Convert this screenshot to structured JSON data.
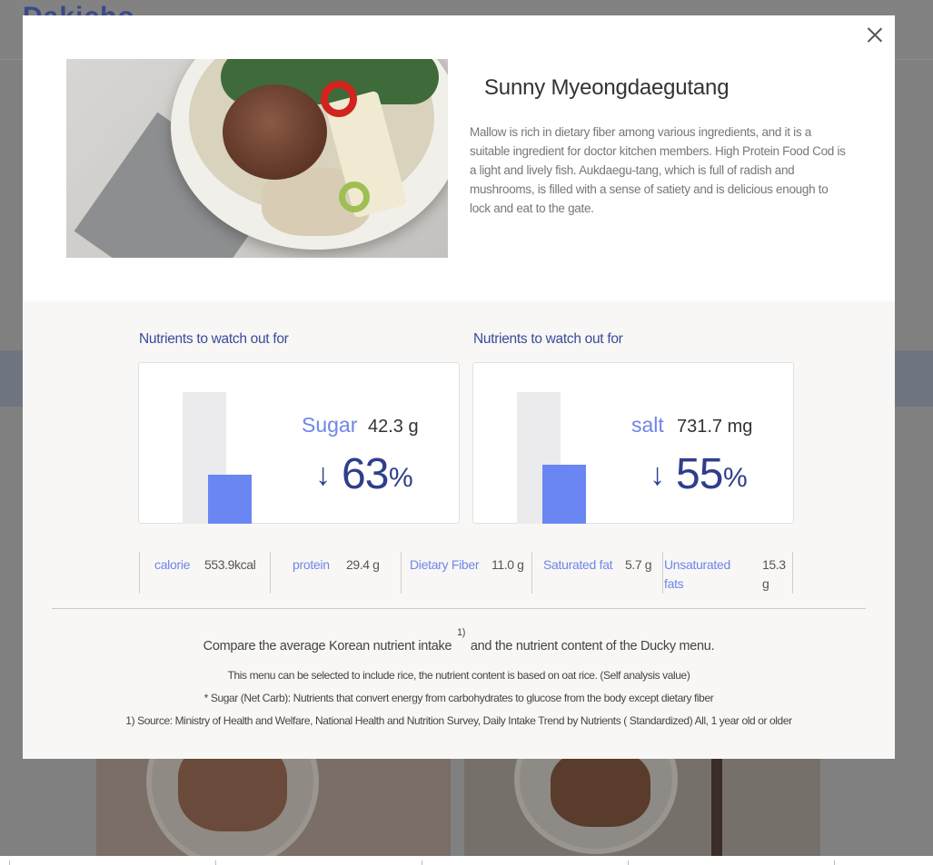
{
  "background": {
    "logo_text": "Dakicho"
  },
  "modal": {
    "close_label": "×",
    "dish": {
      "title": "Sunny Myeongdaegutang",
      "description": "Mallow is rich in dietary fiber among various ingredients, and it is a suitable ingredient for doctor kitchen members. High Protein Food Cod is a light and lively fish. Aukdaegu-tang, which is full of radish and mushrooms, is filled with a sense of satiety and is delicious enough to lock and eat to the gate."
    },
    "panels": [
      {
        "label": "Nutrients to watch out for",
        "nutrient": "Sugar",
        "amount": "42.3 g",
        "arrow": "↓",
        "percent": "63",
        "percent_sign": "%",
        "fill_fraction": 0.37
      },
      {
        "label": "Nutrients to watch out for",
        "nutrient": "salt",
        "amount": "731.7 mg",
        "arrow": "↓",
        "percent": "55",
        "percent_sign": "%",
        "fill_fraction": 0.45
      }
    ],
    "facts": [
      {
        "label": "calorie",
        "value": "553.9kcal"
      },
      {
        "label": "protein",
        "value": "29.4 g"
      },
      {
        "label": "Dietary Fiber",
        "value": "11.0 g"
      },
      {
        "label": "Saturated fat",
        "value": "5.7 g"
      },
      {
        "label": "Unsaturated fats",
        "value": "15.3 g"
      }
    ],
    "compare": {
      "text_before": "Compare the average Korean nutrient intake",
      "superscript": "1)",
      "text_after": "and the nutrient content of the Ducky menu."
    },
    "notes": [
      "This menu can be selected to include rice, the nutrient content is based on oat rice. (Self analysis value)",
      "* Sugar (Net Carb): Nutrients that convert energy from carbohydrates to glucose from the body except dietary fiber",
      "1) Source: Ministry of Health and Welfare, National Health and Nutrition Survey, Daily Intake Trend by Nutrients ( Standardized) All, 1 year old or older"
    ],
    "colors": {
      "accent_blue": "#6f86e8",
      "dark_blue": "#2f3e8a",
      "bar_fill": "#6a86f2",
      "bar_bg": "#ebebed"
    }
  }
}
